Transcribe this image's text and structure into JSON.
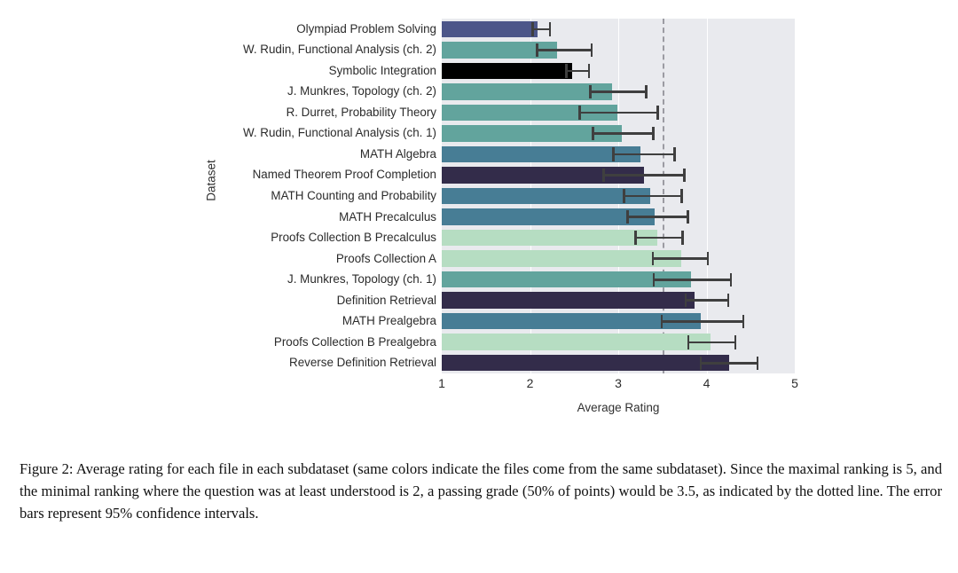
{
  "chart_data": {
    "type": "bar",
    "orientation": "horizontal",
    "title": "",
    "xlabel": "Average Rating",
    "ylabel": "Dataset",
    "xlim": [
      1,
      5
    ],
    "xticks": [
      1,
      2,
      3,
      4,
      5
    ],
    "grid": true,
    "legend": null,
    "annotations": [
      {
        "type": "vline",
        "value": 3.5,
        "style": "dashed",
        "color": "#9b9ba2",
        "label": "passing grade 3.5"
      }
    ],
    "error_bar_type": "95% confidence interval",
    "categories": [
      "Olympiad Problem Solving",
      "W. Rudin, Functional Analysis (ch. 2)",
      "Symbolic Integration",
      "J. Munkres, Topology (ch. 2)",
      "R. Durret, Probability  Theory",
      "W. Rudin, Functional Analysis (ch. 1)",
      "MATH Algebra",
      "Named Theorem Proof Completion",
      "MATH Counting and Probability",
      "MATH Precalculus",
      "Proofs Collection B Precalculus",
      "Proofs Collection A",
      "J. Munkres, Topology (ch. 1)",
      "Definition Retrieval",
      "MATH Prealgebra",
      "Proofs Collection B Prealgebra",
      "Reverse Definition Retrieval"
    ],
    "values": [
      2.09,
      2.31,
      2.48,
      2.93,
      2.99,
      3.04,
      3.25,
      3.29,
      3.36,
      3.41,
      3.44,
      3.71,
      3.82,
      3.86,
      3.93,
      4.05,
      4.26
    ],
    "error_low": [
      2.02,
      2.07,
      2.4,
      2.67,
      2.55,
      2.7,
      2.93,
      2.82,
      3.05,
      3.09,
      3.18,
      3.38,
      3.39,
      3.75,
      3.48,
      3.78,
      3.92
    ],
    "error_high": [
      2.24,
      2.71,
      2.68,
      3.33,
      3.46,
      3.41,
      3.65,
      3.76,
      3.73,
      3.8,
      3.74,
      4.03,
      4.29,
      4.26,
      4.43,
      4.34,
      4.59
    ],
    "bar_colors": [
      "#4c5689",
      "#62a49d",
      "#000000",
      "#62a49d",
      "#62a49d",
      "#62a49d",
      "#477d95",
      "#332c4a",
      "#477d95",
      "#477d95",
      "#b6ddc2",
      "#b6ddc2",
      "#62a49d",
      "#332c4a",
      "#477d95",
      "#b6ddc2",
      "#332c4a"
    ],
    "colors": {
      "plot_background": "#e9eaee",
      "gridline": "#ffffff",
      "error_bar": "#3f3f3f",
      "threshold_line": "#9b9ba2",
      "text": "#2b2b2b"
    }
  },
  "caption": {
    "label": "Figure 2:",
    "text": "Average rating for each file in each subdataset (same colors indicate the files come from the same subdataset). Since the maximal ranking is 5, and the minimal ranking where the question was at least understood is 2, a passing grade (50% of points) would be 3.5, as indicated by the dotted line. The error bars represent 95% confidence intervals."
  }
}
